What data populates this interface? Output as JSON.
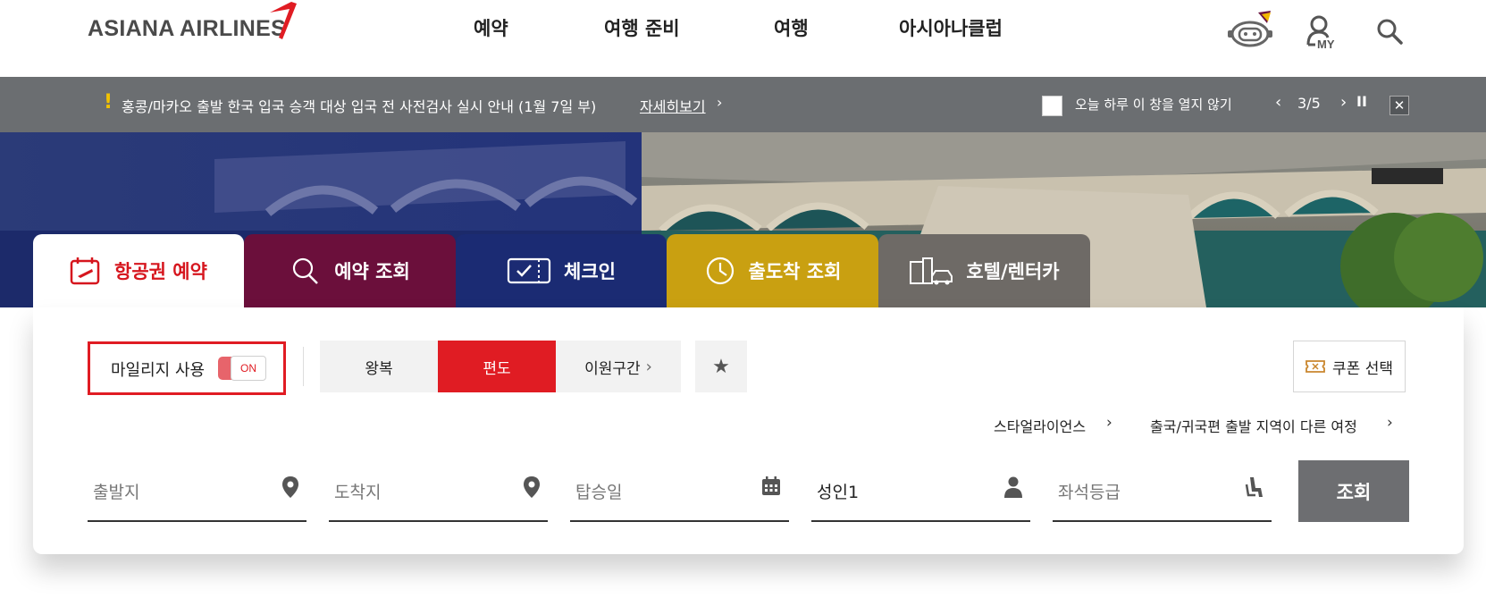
{
  "header": {
    "logo": "ASIANA AIRLINES",
    "nav": [
      "예약",
      "여행 준비",
      "여행",
      "아시아나클럽"
    ],
    "icons": [
      "chatbot-icon",
      "my-page-icon",
      "search-icon"
    ],
    "my_label": "MY"
  },
  "notice": {
    "excl": "!",
    "text": "홍콩/마카오 출발 한국 입국 승객 대상 입국 전 사전검사 실시 안내 (1월 7일 부)",
    "more": "자세히보기",
    "chevron": "›",
    "hide_today": "오늘 하루 이 창을 열지 않기",
    "prev": "‹",
    "page": "3/5",
    "next": "›",
    "pause": "II",
    "close": "✕"
  },
  "tabs": [
    {
      "label": "항공권 예약",
      "bg": "#ffffff",
      "fg": "#d6161e"
    },
    {
      "label": "예약 조회",
      "bg": "#6b0f3b",
      "fg": "#ffffff"
    },
    {
      "label": "체크인",
      "bg": "#1b2b73",
      "fg": "#ffffff"
    },
    {
      "label": "출도착 조회",
      "bg": "#c9a011",
      "fg": "#ffffff"
    },
    {
      "label": "호텔/렌터카",
      "bg": "#6e6a66",
      "fg": "#ffffff"
    }
  ],
  "booking": {
    "mileage_label": "마일리지 사용",
    "mileage_toggle": "ON",
    "trip_types": [
      "왕복",
      "편도",
      "이원구간"
    ],
    "trip_chevron": "›",
    "selected_trip": "편도",
    "star": "★",
    "coupon": "쿠폰 선택",
    "links": [
      "스타얼라이언스",
      "출국/귀국편 출발 지역이 다른 여정"
    ],
    "link_chevron": "›",
    "fields": [
      "출발지",
      "도착지",
      "탑승일",
      "성인1",
      "좌석등급"
    ],
    "search": "조회"
  },
  "colors": {
    "accent": "#e01c23",
    "notice_bg": "#6b6e71",
    "search_btn": "#6d6e71"
  }
}
